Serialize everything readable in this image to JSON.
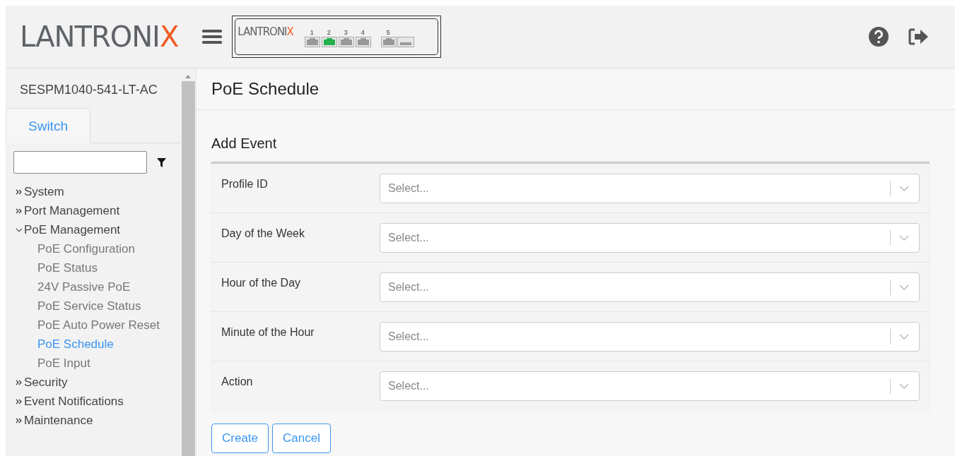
{
  "header": {
    "logo": {
      "text": "LANTRONI",
      "accent": "X"
    },
    "device": {
      "logo": {
        "text": "LANTRONI",
        "accent": "X"
      },
      "ports": [
        {
          "label": "1",
          "link": false,
          "kind": "rj45"
        },
        {
          "label": "2",
          "link": true,
          "kind": "rj45"
        },
        {
          "label": "3",
          "link": false,
          "kind": "rj45"
        },
        {
          "label": "4",
          "link": false,
          "kind": "rj45"
        },
        {
          "label": "5",
          "link": false,
          "kind": "combo"
        }
      ]
    }
  },
  "sidebar": {
    "device_name": "SESPM1040-541-LT-AC",
    "tabs": [
      {
        "label": "Switch",
        "selected": true
      }
    ],
    "items": [
      {
        "label": "System",
        "expanded": false,
        "selected": false
      },
      {
        "label": "Port Management",
        "expanded": false,
        "selected": false
      },
      {
        "label": "PoE Management",
        "expanded": true,
        "selected": false,
        "children": [
          {
            "label": "PoE Configuration",
            "selected": false
          },
          {
            "label": "PoE Status",
            "selected": false
          },
          {
            "label": "24V Passive PoE",
            "selected": false
          },
          {
            "label": "PoE Service Status",
            "selected": false
          },
          {
            "label": "PoE Auto Power Reset",
            "selected": false
          },
          {
            "label": "PoE Schedule",
            "selected": true
          },
          {
            "label": "PoE Input",
            "selected": false
          }
        ]
      },
      {
        "label": "Security",
        "expanded": false,
        "selected": false
      },
      {
        "label": "Event Notifications",
        "expanded": false,
        "selected": false
      },
      {
        "label": "Maintenance",
        "expanded": false,
        "selected": false
      }
    ]
  },
  "page": {
    "title": "PoE Schedule",
    "section": "Add Event",
    "fields": [
      {
        "label": "Profile ID",
        "placeholder": "Select..."
      },
      {
        "label": "Day of the Week",
        "placeholder": "Select..."
      },
      {
        "label": "Hour of the Day",
        "placeholder": "Select..."
      },
      {
        "label": "Minute of the Hour",
        "placeholder": "Select..."
      },
      {
        "label": "Action",
        "placeholder": "Select..."
      }
    ],
    "buttons": [
      "Create",
      "Cancel"
    ]
  }
}
